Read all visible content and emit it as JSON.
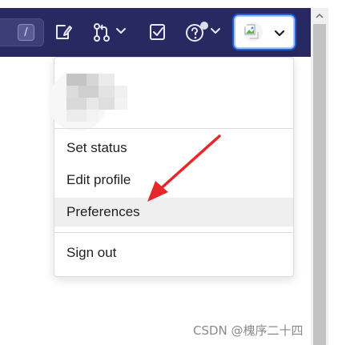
{
  "search": {
    "shortcut_key": "/"
  },
  "nav": {
    "icons": [
      "issues-icon",
      "merge-request-icon",
      "chevron-down-icon",
      "todo-icon",
      "help-icon",
      "chevron-down-icon"
    ],
    "background": "#292961"
  },
  "user_menu": {
    "items": [
      {
        "label": "Set status"
      },
      {
        "label": "Edit profile"
      },
      {
        "label": "Preferences"
      },
      {
        "label": "Sign out"
      }
    ],
    "hovered_item": "Preferences"
  },
  "annotation": {
    "arrow_color": "#e8272a"
  },
  "watermark": {
    "text": "CSDN @槐序二十四"
  }
}
